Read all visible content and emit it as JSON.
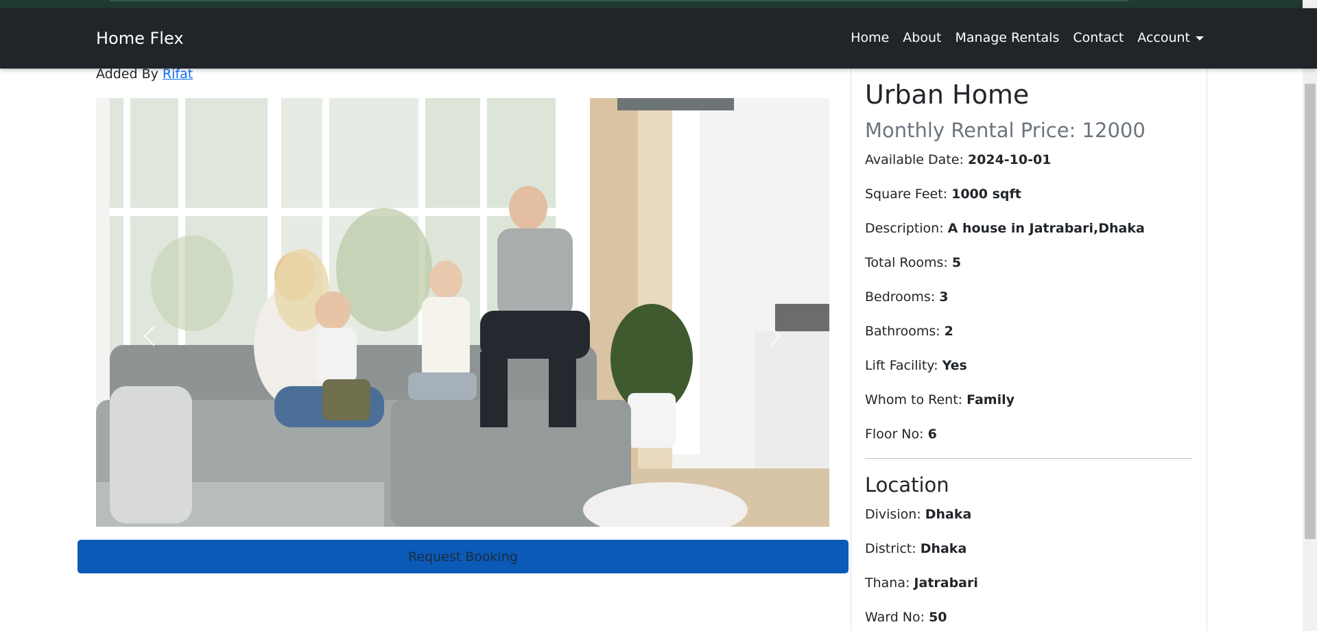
{
  "navbar": {
    "brand": "Home Flex",
    "links": [
      "Home",
      "About",
      "Manage Rentals",
      "Contact",
      "Account"
    ]
  },
  "listing": {
    "added_by_label": "Added By",
    "added_by_user": "Rifat",
    "title": "Urban Home",
    "price": "Monthly Rental Price: 12000",
    "fields": [
      {
        "label": "Available Date: ",
        "value": "2024-10-01"
      },
      {
        "label": "Square Feet: ",
        "value": "1000 sqft"
      },
      {
        "label": "Description: ",
        "value": "A house in Jatrabari,Dhaka"
      },
      {
        "label": "Total Rooms: ",
        "value": "5"
      },
      {
        "label": "Bedrooms: ",
        "value": "3"
      },
      {
        "label": "Bathrooms: ",
        "value": "2"
      },
      {
        "label": "Lift Facility: ",
        "value": "Yes"
      },
      {
        "label": "Whom to Rent: ",
        "value": "Family"
      },
      {
        "label": "Floor No: ",
        "value": "6"
      }
    ],
    "location_heading": "Location",
    "location": [
      {
        "label": "Division: ",
        "value": "Dhaka"
      },
      {
        "label": "District: ",
        "value": "Dhaka"
      },
      {
        "label": "Thana: ",
        "value": "Jatrabari"
      },
      {
        "label": "Ward No: ",
        "value": "50"
      }
    ]
  },
  "actions": {
    "request_booking": "Request Booking"
  },
  "icons": {
    "carousel_prev": "chevron-left-icon",
    "carousel_next": "chevron-right-icon",
    "dropdown": "caret-down-icon"
  },
  "colors": {
    "navbar_bg": "#212529",
    "primary": "#0b5ab8",
    "link": "#0d6efd",
    "muted": "#6c757d"
  }
}
